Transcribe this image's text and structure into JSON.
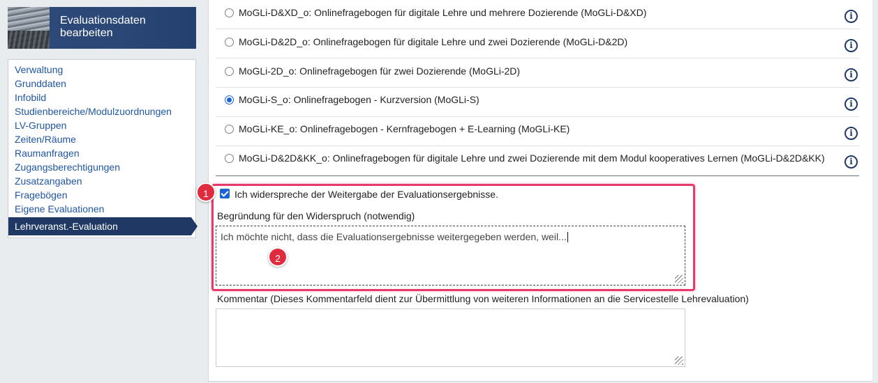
{
  "header": {
    "title_line1": "Evaluationsdaten",
    "title_line2": "bearbeiten"
  },
  "nav": {
    "items": [
      "Verwaltung",
      "Grunddaten",
      "Infobild",
      "Studienbereiche/Modulzuordnungen",
      "LV-Gruppen",
      "Zeiten/Räume",
      "Raumanfragen",
      "Zugangsberechtigungen",
      "Zusatzangaben",
      "Fragebögen",
      "Eigene Evaluationen"
    ],
    "active": "Lehrveranst.-Evaluation"
  },
  "options": [
    {
      "label": "MoGLi-D&XD_o: Onlinefragebogen für digitale Lehre und mehrere Dozierende (MoGLi-D&XD)",
      "checked": false
    },
    {
      "label": "MoGLi-D&2D_o: Onlinefragebogen für digitale Lehre und zwei Dozierende (MoGLi-D&2D)",
      "checked": false
    },
    {
      "label": "MoGLi-2D_o: Onlinefragebogen für zwei Dozierende (MoGLi-2D)",
      "checked": false
    },
    {
      "label": "MoGLi-S_o: Onlinefragebogen - Kurzversion (MoGLi-S)",
      "checked": true
    },
    {
      "label": "MoGLi-KE_o: Onlinefragebogen - Kernfragebogen + E-Learning (MoGLi-KE)",
      "checked": false
    },
    {
      "label": "MoGLi-D&2D&KK_o: Onlinefragebogen für digitale Lehre und zwei Dozierende mit dem Modul kooperatives Lernen (MoGLi-D&2D&KK)",
      "checked": false
    }
  ],
  "objection": {
    "checkbox_label": "Ich widerspreche der Weitergabe der Evaluationsergebnisse.",
    "reason_label": "Begründung für den Widerspruch (notwendig)",
    "reason_value": "Ich möchte nicht, dass die Evaluationsergebnisse weitergegeben werden, weil..."
  },
  "comment": {
    "label": "Kommentar (Dieses Kommentarfeld dient zur Übermittlung von weiteren Informationen an die Servicestelle Lehrevaluation)",
    "value": ""
  },
  "badges": {
    "one": "1",
    "two": "2"
  },
  "icons": {
    "info": "info-icon",
    "checkbox": "checkbox-checked"
  },
  "colors": {
    "accent": "#1a63d6",
    "nav_active": "#1f3864",
    "highlight": "#e83a6a",
    "badge": "#e02b3f",
    "link": "#1f56a3"
  }
}
